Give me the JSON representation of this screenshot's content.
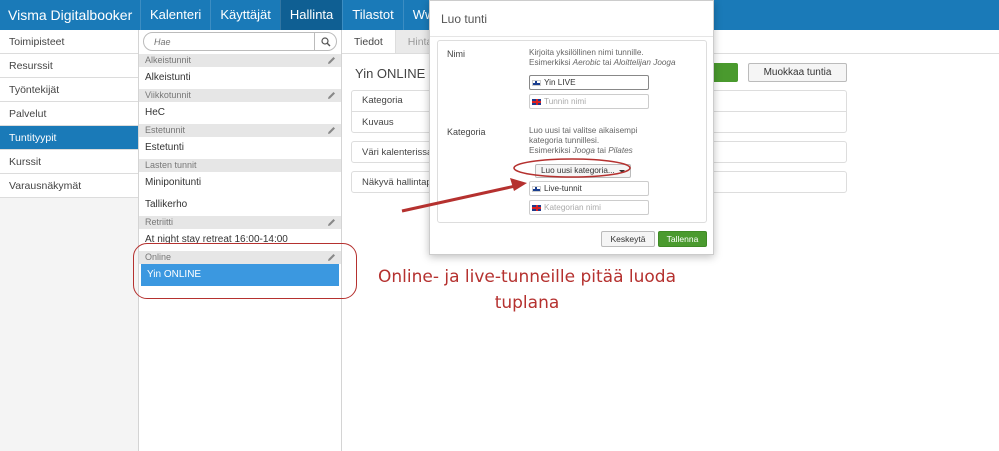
{
  "topbar": {
    "brand": "Visma Digitalbooker",
    "nav": [
      "Kalenteri",
      "Käyttäjät",
      "Hallinta",
      "Tilastot",
      "Ww"
    ],
    "active_index": 2
  },
  "sidebar": {
    "items": [
      "Toimipisteet",
      "Resurssit",
      "Työntekijät",
      "Palvelut",
      "Tuntityypit",
      "Kurssit",
      "Varausnäkymät"
    ],
    "active_index": 4
  },
  "list": {
    "search_placeholder": "Hae",
    "groups": [
      {
        "name": "Alkeistunnit",
        "items": [
          "Alkeistunti"
        ]
      },
      {
        "name": "Viikkotunnit",
        "items": [
          "HeC"
        ]
      },
      {
        "name": "Estetunnit",
        "items": [
          "Estetunti"
        ]
      },
      {
        "name": "Lasten tunnit",
        "items": [
          "Miniponitunti",
          "Tallikerho"
        ]
      },
      {
        "name": "Retriitti",
        "items": [
          "At night stay retreat 16:00-14:00"
        ]
      },
      {
        "name": "Online",
        "items": [
          "Yin ONLINE"
        ]
      }
    ]
  },
  "content": {
    "tabs": [
      "Tiedot",
      "Hinta"
    ],
    "title": "Yin ONLINE",
    "edit_button": "Muokkaa tuntia",
    "fields": [
      "Kategoria",
      "Kuvaus",
      "Väri kalenterissa",
      "Näkyvä hallintapu"
    ]
  },
  "modal": {
    "title": "Luo tunti",
    "name_label": "Nimi",
    "name_help": "Kirjoita yksilöllinen nimi tunnille.",
    "name_example_prefix": "Esimerkiksi ",
    "name_example_1": "Aerobic",
    "name_example_mid": " tai ",
    "name_example_2": "Aloittelijan Jooga",
    "name_fi_value": "Yin LIVE",
    "name_en_placeholder": "Tunnin nimi",
    "category_label": "Kategoria",
    "category_help": "Luo uusi tai valitse aikaisempi kategoria tunnillesi.",
    "category_example_prefix": "Esimerkiksi ",
    "category_example_1": "Jooga",
    "category_example_mid": " tai ",
    "category_example_2": "Pilates",
    "category_dropdown": "Luo uusi kategoria...",
    "category_fi_value": "Live-tunnit",
    "category_en_placeholder": "Kategorian nimi",
    "cancel": "Keskeytä",
    "save": "Tallenna"
  },
  "annotation": {
    "text": "Online- ja live-tunneille pitää luoda tuplana"
  },
  "colors": {
    "brand_blue": "#1a7ab8",
    "selected_blue": "#3b98e0",
    "save_green": "#4a9a2e",
    "annotation_red": "#b5312f"
  }
}
